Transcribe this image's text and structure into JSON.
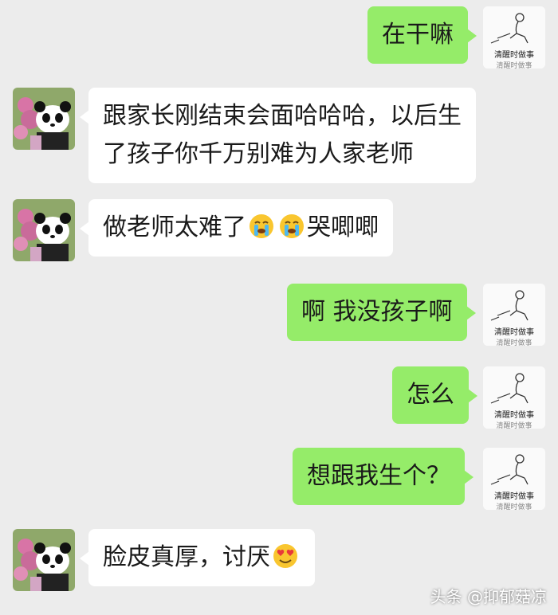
{
  "messages": [
    {
      "side": "out",
      "text": "在干嘛"
    },
    {
      "side": "in",
      "line1": "跟家长刚结束会面哈哈哈，以后生",
      "line2": "了孩子你千万别难为人家老师"
    },
    {
      "side": "in",
      "before": "做老师太难了",
      "emojis": [
        "crying-face-icon",
        "crying-face-icon"
      ],
      "after": "哭唧唧"
    },
    {
      "side": "out",
      "text": "啊 我没孩子啊"
    },
    {
      "side": "out",
      "text": "怎么"
    },
    {
      "side": "out",
      "text": "想跟我生个？"
    },
    {
      "side": "in",
      "before": "脸皮真厚，讨厌",
      "emojis": [
        "heart-eyes-face-icon"
      ]
    }
  ],
  "avatars": {
    "self": {
      "caption": "清醒时做事"
    }
  },
  "watermark": "头条 @抑郁菇凉",
  "colors": {
    "background": "#ececec",
    "outgoing_bubble": "#95ec69",
    "incoming_bubble": "#ffffff"
  }
}
